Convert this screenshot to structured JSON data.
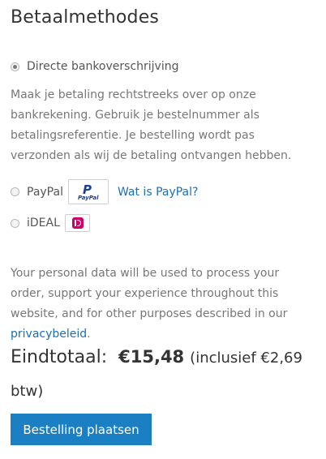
{
  "section_title": "Betaalmethodes",
  "methods": {
    "bank": {
      "label": "Directe bankoverschrijving",
      "selected": true,
      "description": "Maak je betaling rechtstreeks over op onze bankrekening. Gebruik je bestelnummer als betalingsreferentie. Je bestelling wordt pas verzonden als wij de betaling ontvangen hebben."
    },
    "paypal": {
      "label": "PayPal",
      "selected": false,
      "logo_p": "P",
      "logo_text": "PayPal",
      "link_text": "Wat is PayPal?"
    },
    "ideal": {
      "label": "iDEAL",
      "selected": false
    }
  },
  "privacy": {
    "text": "Your personal data will be used to process your order, support your experience throughout this website, and for other purposes described in our ",
    "link_text": "privacybeleid",
    "suffix": "."
  },
  "total": {
    "label": "Eindtotaal:",
    "amount": "€15,48",
    "tax_note": "(inclusief €2,69 btw)"
  },
  "place_order_label": "Bestelling plaatsen",
  "colors": {
    "accent": "#1a7fc3",
    "link": "#1a6fb5",
    "ideal": "#cc0066",
    "paypal": "#1e3f8f"
  }
}
